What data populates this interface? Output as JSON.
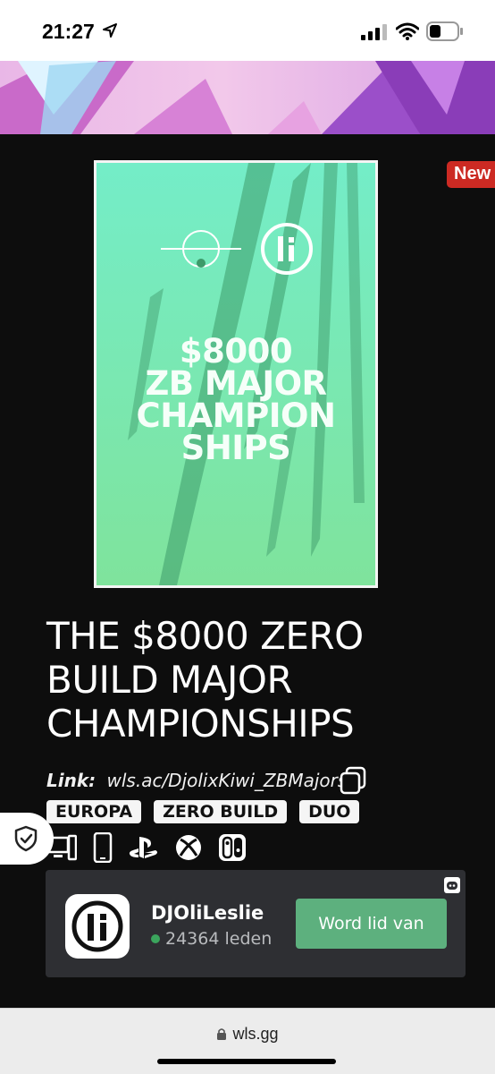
{
  "status": {
    "time": "21:27"
  },
  "badge": {
    "new_label": "New"
  },
  "poster": {
    "title_lines": [
      "$8000",
      "ZB MAJOR",
      "CHAMPION",
      "SHIPS"
    ]
  },
  "tournament": {
    "title_lines": [
      "THE $8000 ZERO",
      "BUILD MAJOR",
      "CHAMPIONSHIPS"
    ],
    "link_label": "Link:",
    "link_value": "wls.ac/DjolixKiwi_ZBMajors",
    "tags": [
      "EUROPA",
      "ZERO BUILD",
      "DUO"
    ],
    "platform_icons": [
      "pc-icon",
      "mobile-icon",
      "playstation-icon",
      "xbox-icon",
      "switch-icon"
    ]
  },
  "discord": {
    "server_name": "DJOliLeslie",
    "members_count": "24364",
    "members_label": "leden",
    "join_label": "Word lid van"
  },
  "browser": {
    "url": "wls.gg"
  },
  "colors": {
    "poster_bg_top": "#74edc8",
    "poster_bg_bottom": "#7fe39c",
    "badge_red": "#cc2a23",
    "join_green": "#5db07e"
  }
}
